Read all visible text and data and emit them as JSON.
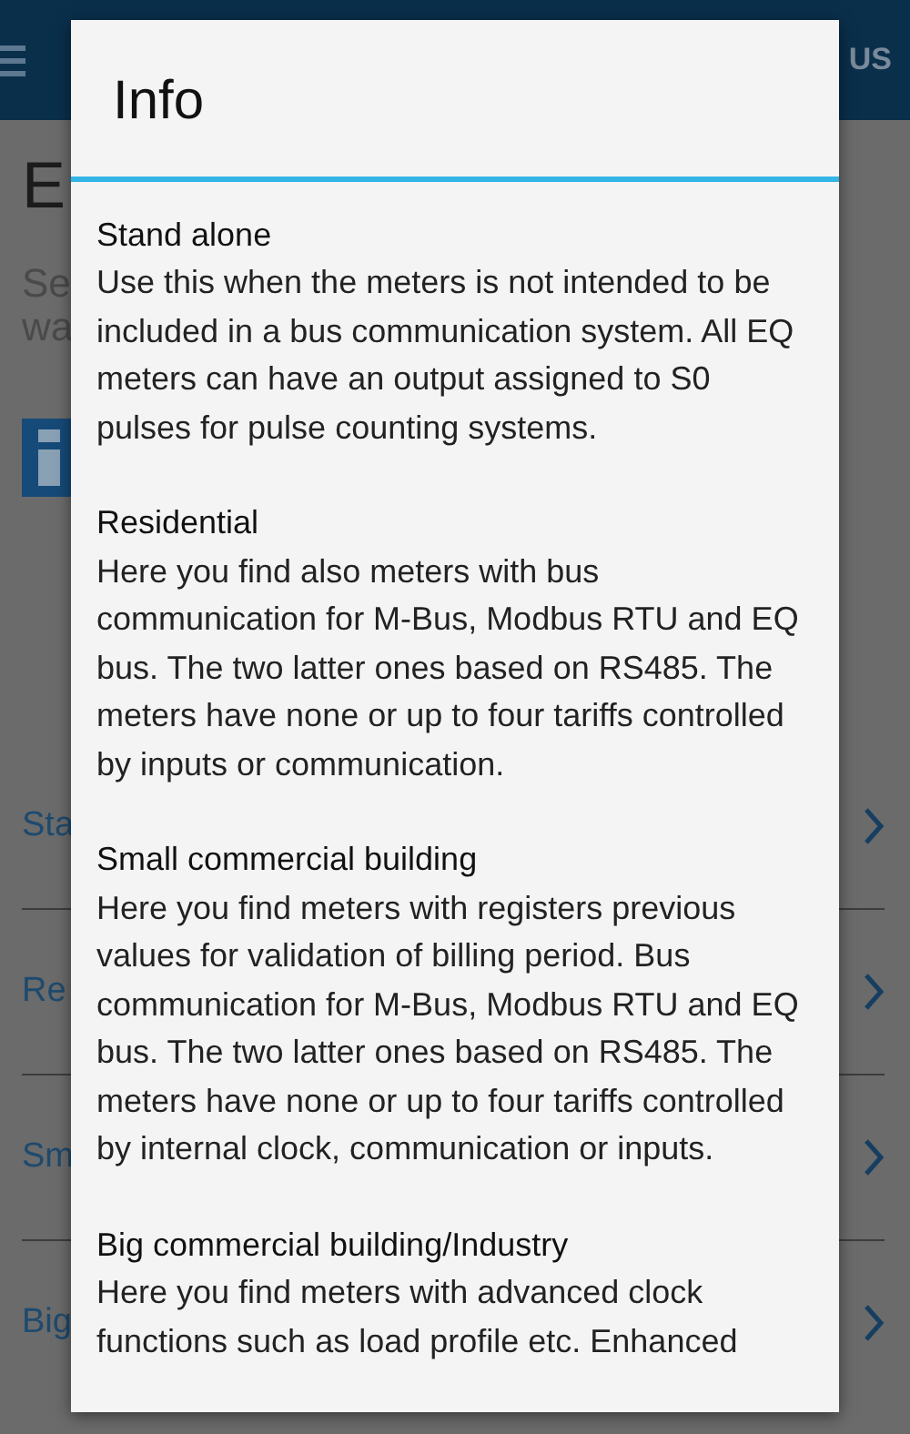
{
  "app_bar": {
    "action": "US"
  },
  "page": {
    "title": "E",
    "subtitle_lines": [
      "Se",
      "wa"
    ],
    "items": [
      {
        "label": "Sta"
      },
      {
        "label": "Re"
      },
      {
        "label": "Sm"
      },
      {
        "label": "Big"
      }
    ]
  },
  "dialog": {
    "title": "Info",
    "sections": [
      {
        "heading": "Stand alone",
        "body": "Use this when the meters is not intended to be included in a bus communication system. All EQ meters can have an output assigned to S0 pulses for pulse counting systems."
      },
      {
        "heading": "Residential",
        "body": "Here you find also meters with bus communication for M-Bus, Modbus RTU and EQ bus. The two latter ones based on RS485. The meters have none or up to four tariffs controlled by inputs or communication."
      },
      {
        "heading": "Small commercial building",
        "body": "Here you find meters with registers previous values for validation of billing period. Bus communication for M-Bus, Modbus RTU and EQ bus. The two latter ones based on RS485. The meters have none or up to four tariffs controlled by internal clock, communication or inputs."
      },
      {
        "heading": "Big commercial building/Industry",
        "body": "Here you find meters with advanced clock functions such as load profile etc. Enhanced"
      }
    ]
  }
}
